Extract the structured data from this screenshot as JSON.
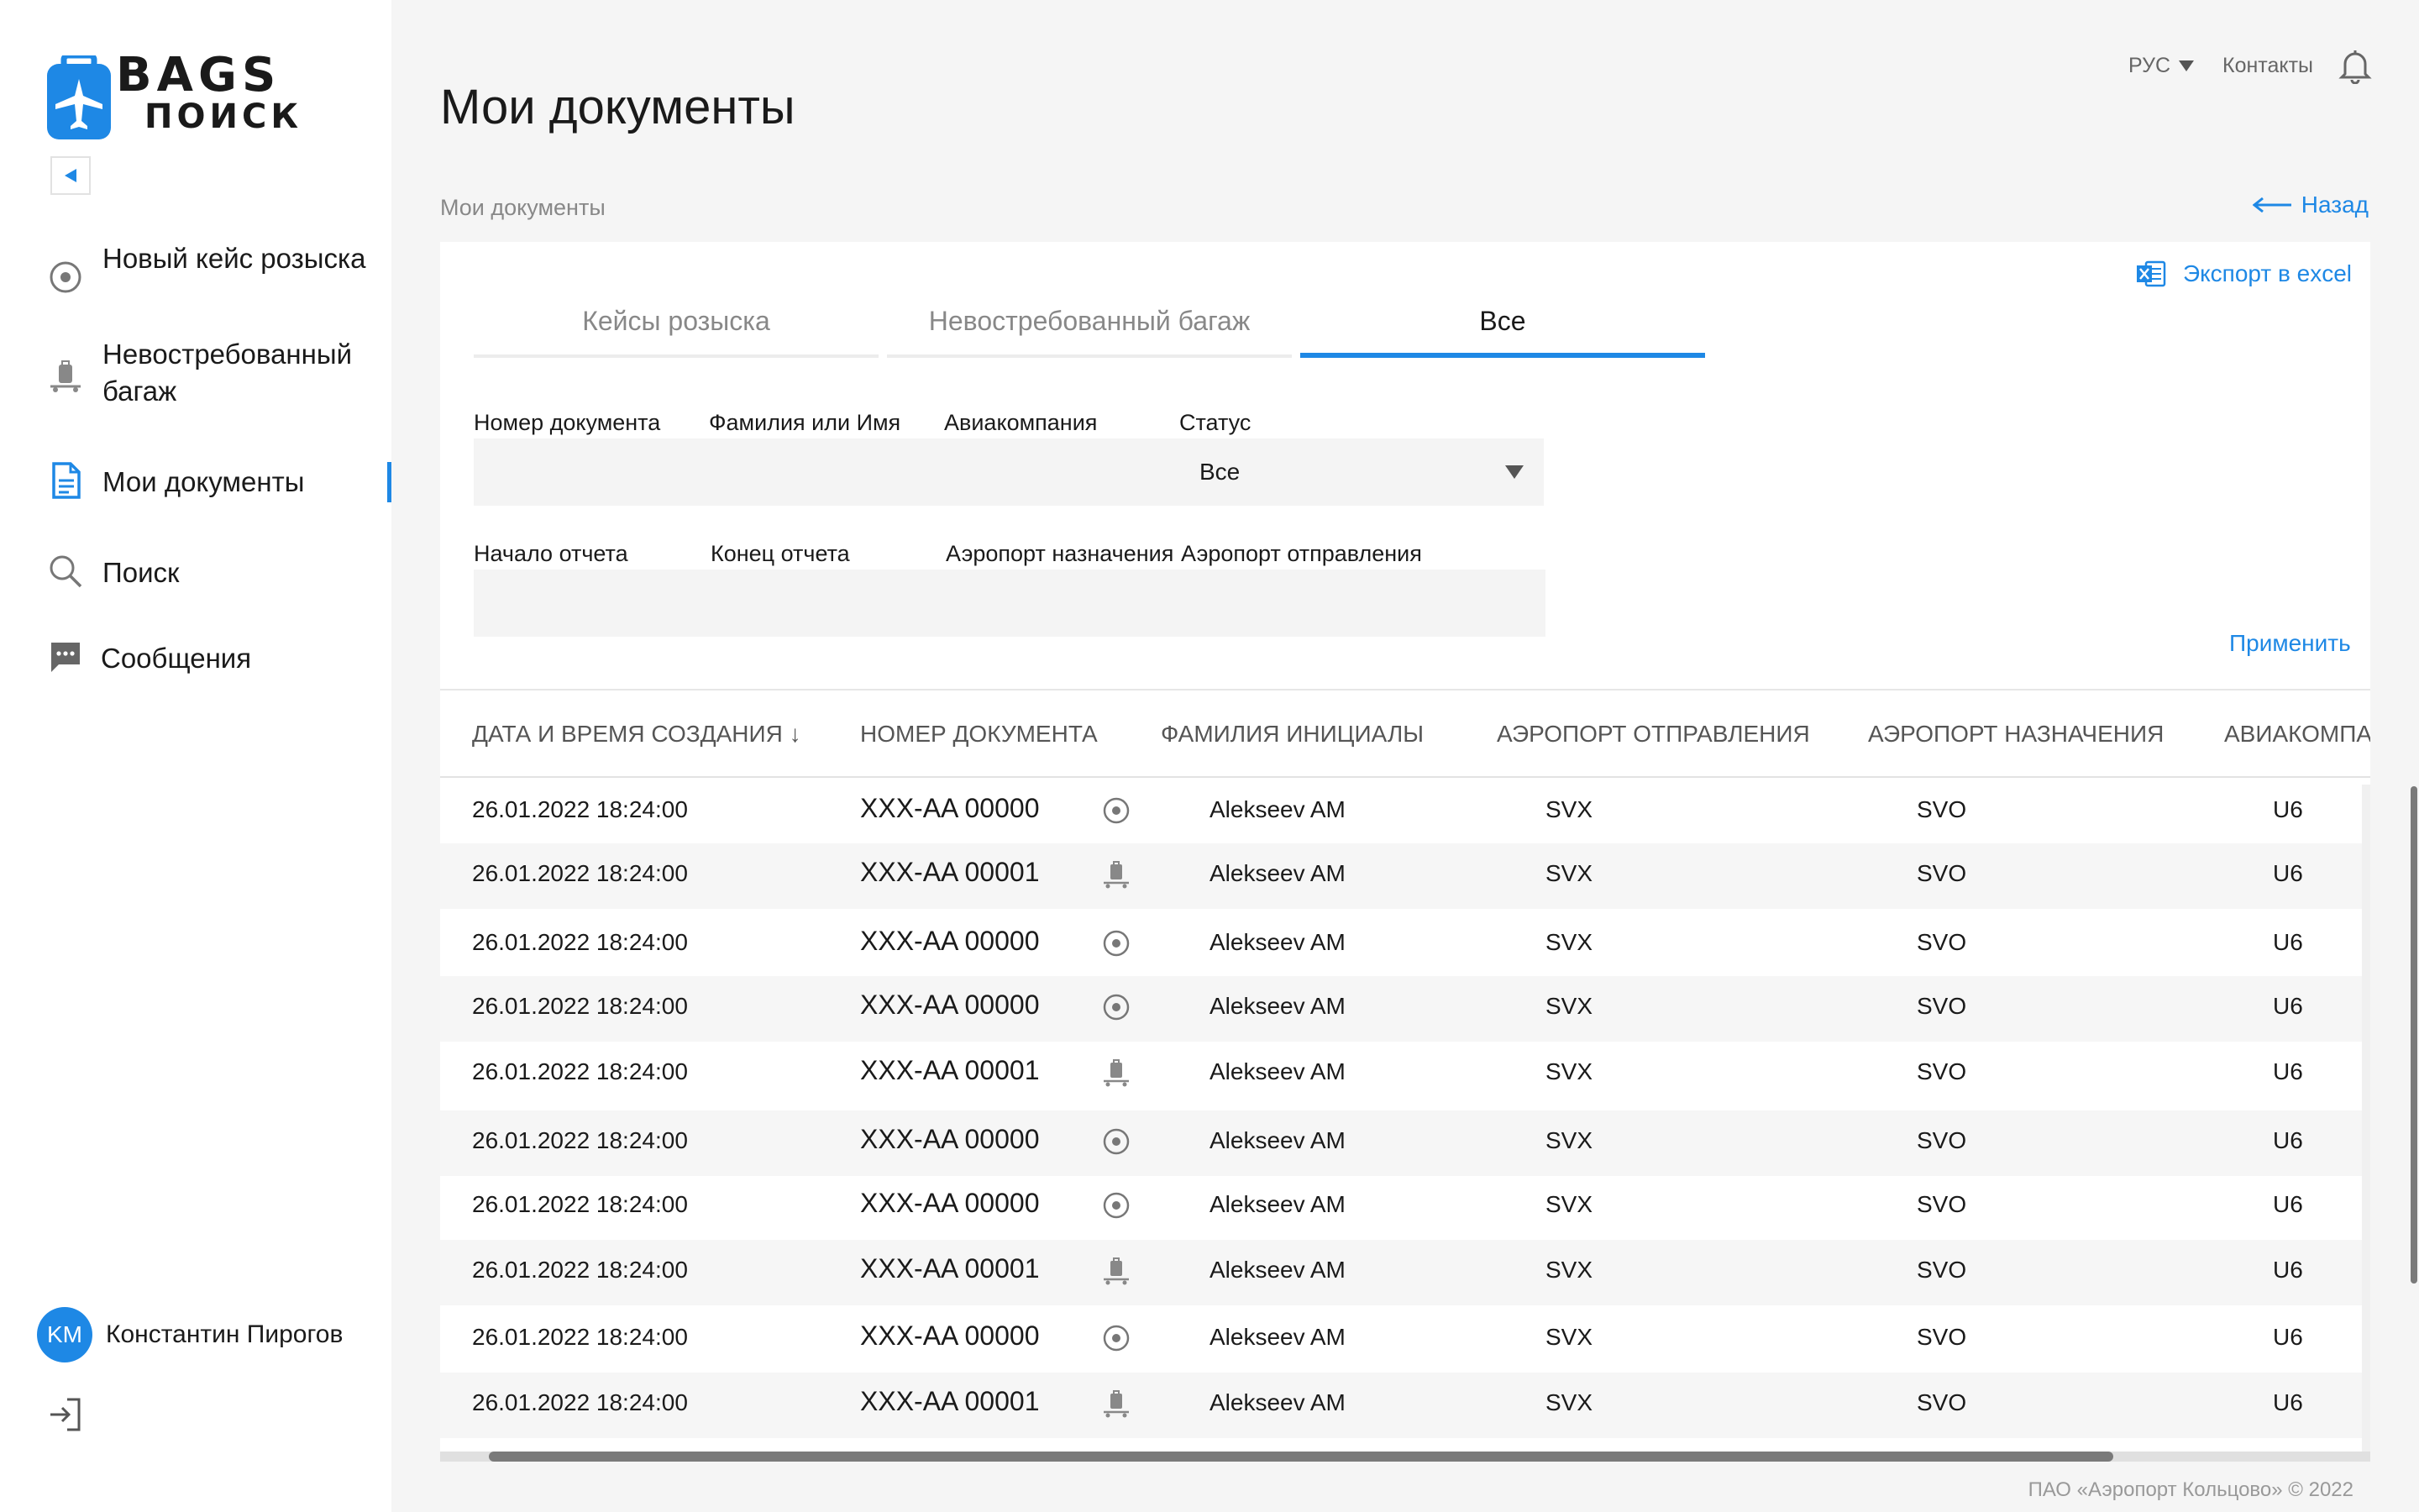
{
  "brand": {
    "line1": "BAGS",
    "line2": "ПОИСК",
    "accent": "#1e88e5"
  },
  "sidebar": {
    "items": [
      {
        "label": "Новый кейс розыска",
        "icon": "target-circle-icon"
      },
      {
        "label": "Невостребованный багаж",
        "icon": "baggage-cart-icon"
      },
      {
        "label": "Мои документы",
        "icon": "document-icon",
        "active": true
      },
      {
        "label": "Поиск",
        "icon": "search-icon"
      },
      {
        "label": "Сообщения",
        "icon": "chat-icon"
      }
    ],
    "user": {
      "initials": "KM",
      "name": "Константин Пирогов"
    }
  },
  "topbar": {
    "lang": "РУС",
    "contacts": "Контакты"
  },
  "page": {
    "title": "Мои документы",
    "breadcrumb": "Мои документы",
    "back": "Назад",
    "export": "Экспорт в excel"
  },
  "tabs": [
    {
      "label": "Кейсы розыска",
      "active": false
    },
    {
      "label": "Невостребованный багаж",
      "active": false
    },
    {
      "label": "Все",
      "active": true
    }
  ],
  "filters": {
    "doc_number": {
      "label": "Номер документа",
      "value": ""
    },
    "surname": {
      "label": "Фамилия или Имя",
      "value": ""
    },
    "airline": {
      "label": "Авиакомпания",
      "value": ""
    },
    "status": {
      "label": "Статус",
      "value": "Все"
    },
    "start": {
      "label": "Начало отчета",
      "value": ""
    },
    "end": {
      "label": "Конец отчета",
      "value": ""
    },
    "dest_airport": {
      "label": "Аэропорт назначения",
      "value": ""
    },
    "dep_airport": {
      "label": "Аэропорт отправления",
      "value": ""
    },
    "apply": "Применить"
  },
  "table": {
    "columns": [
      "ДАТА И ВРЕМЯ СОЗДАНИЯ ↓",
      "НОМЕР ДОКУМЕНТА",
      "ФАМИЛИЯ ИНИЦИАЛЫ",
      "АЭРОПОРТ ОТПРАВЛЕНИЯ",
      "АЭРОПОРТ НАЗНАЧЕНИЯ",
      "АВИАКОМПА"
    ],
    "rows": [
      {
        "date": "26.01.2022 18:24:00",
        "doc": "XXX-AA 00000",
        "icon": "target-circle-icon",
        "name": "Alekseev AM",
        "dep": "SVX",
        "dest": "SVO",
        "airline": "U6"
      },
      {
        "date": "26.01.2022 18:24:00",
        "doc": "XXX-AA 00001",
        "icon": "baggage-cart-icon",
        "name": "Alekseev AM",
        "dep": "SVX",
        "dest": "SVO",
        "airline": "U6"
      },
      {
        "date": "26.01.2022 18:24:00",
        "doc": "XXX-AA 00000",
        "icon": "target-circle-icon",
        "name": "Alekseev AM",
        "dep": "SVX",
        "dest": "SVO",
        "airline": "U6"
      },
      {
        "date": "26.01.2022 18:24:00",
        "doc": "XXX-AA 00000",
        "icon": "target-circle-icon",
        "name": "Alekseev AM",
        "dep": "SVX",
        "dest": "SVO",
        "airline": "U6"
      },
      {
        "date": "26.01.2022 18:24:00",
        "doc": "XXX-AA 00001",
        "icon": "baggage-cart-icon",
        "name": "Alekseev AM",
        "dep": "SVX",
        "dest": "SVO",
        "airline": "U6"
      },
      {
        "date": "26.01.2022 18:24:00",
        "doc": "XXX-AA 00000",
        "icon": "target-circle-icon",
        "name": "Alekseev AM",
        "dep": "SVX",
        "dest": "SVO",
        "airline": "U6"
      },
      {
        "date": "26.01.2022 18:24:00",
        "doc": "XXX-AA 00000",
        "icon": "target-circle-icon",
        "name": "Alekseev AM",
        "dep": "SVX",
        "dest": "SVO",
        "airline": "U6"
      },
      {
        "date": "26.01.2022 18:24:00",
        "doc": "XXX-AA 00001",
        "icon": "baggage-cart-icon",
        "name": "Alekseev AM",
        "dep": "SVX",
        "dest": "SVO",
        "airline": "U6"
      },
      {
        "date": "26.01.2022 18:24:00",
        "doc": "XXX-AA 00000",
        "icon": "target-circle-icon",
        "name": "Alekseev AM",
        "dep": "SVX",
        "dest": "SVO",
        "airline": "U6"
      },
      {
        "date": "26.01.2022 18:24:00",
        "doc": "XXX-AA 00001",
        "icon": "baggage-cart-icon",
        "name": "Alekseev AM",
        "dep": "SVX",
        "dest": "SVO",
        "airline": "U6"
      }
    ]
  },
  "footer": "ПАО «Аэропорт Кольцово» © 2022"
}
